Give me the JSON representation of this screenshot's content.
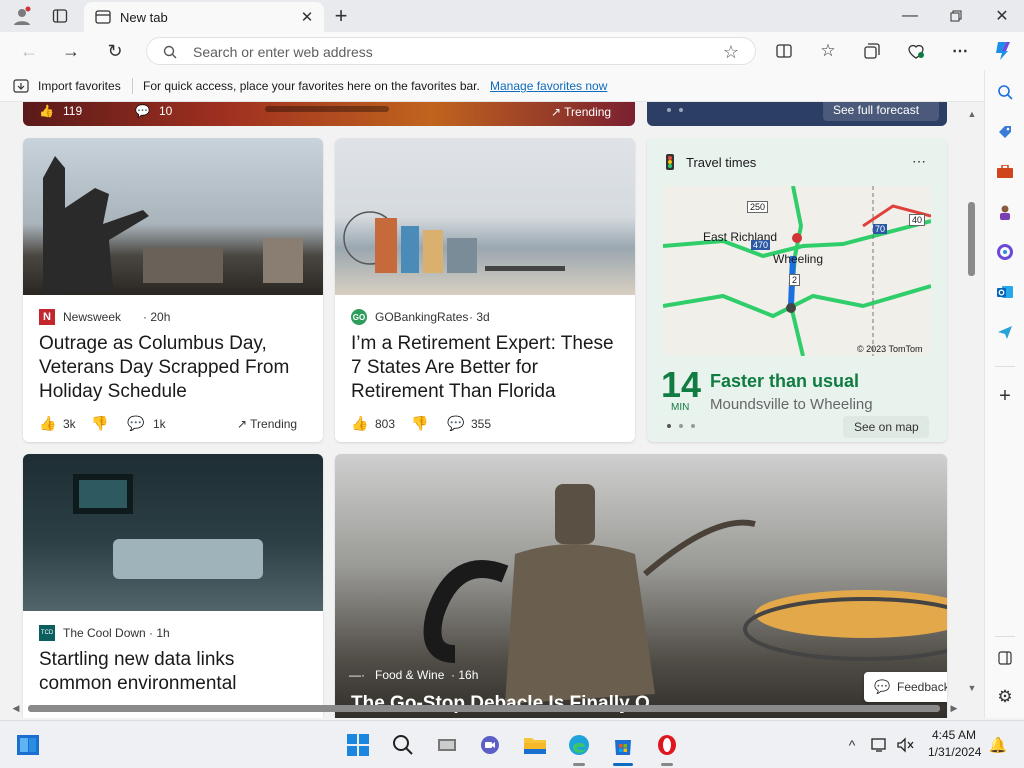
{
  "browser": {
    "tab_title": "New tab",
    "address_placeholder": "Search or enter web address"
  },
  "favorites_bar": {
    "import_label": "Import favorites",
    "hint": "For quick access, place your favorites here on the favorites bar.",
    "manage_link": "Manage favorites now"
  },
  "top_strip": {
    "likes": "119",
    "comments": "10",
    "trending": "Trending",
    "forecast_link": "See full forecast"
  },
  "cards": [
    {
      "source": "Newsweek",
      "age": "20h",
      "headline": "Outrage as Columbus Day, Veterans Day Scrapped From Holiday Schedule",
      "likes": "3k",
      "comments": "1k",
      "trending": "Trending"
    },
    {
      "source": "GOBankingRates",
      "age": "3d",
      "headline": "I’m a Retirement Expert: These 7 States Are Better for Retirement Than Florida",
      "likes": "803",
      "comments": "355"
    },
    {
      "source": "The Cool Down",
      "age": "1h",
      "headline": "Startling new data links common environmental"
    },
    {
      "source": "Food & Wine",
      "age": "16h",
      "headline": "The Go-Stop Debacle Is Finally O..."
    }
  ],
  "travel": {
    "title": "Travel times",
    "minutes": "14",
    "min_label": "MIN",
    "status": "Faster than usual",
    "route": "Moundsville to Wheeling",
    "map_link": "See on map",
    "map_labels": {
      "east_richland": "East Richland",
      "wheeling": "Wheeling",
      "copyright": "© 2023 TomTom",
      "r250": "250",
      "r470": "470",
      "r70": "70",
      "r40": "40",
      "r2": "2"
    }
  },
  "feedback": "Feedback",
  "clock": {
    "time": "4:45 AM",
    "date": "1/31/2024"
  },
  "colors": {
    "accent": "#0f6cbd",
    "green_status": "#107c41",
    "bg": "#f2f2f2"
  }
}
